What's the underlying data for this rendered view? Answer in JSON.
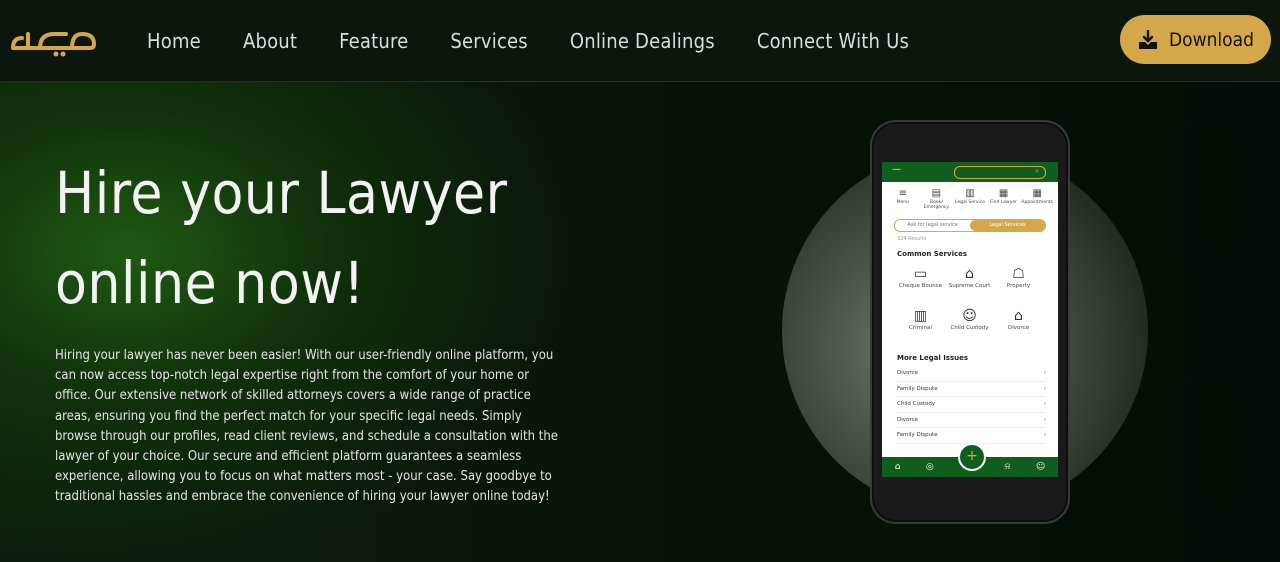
{
  "nav": {
    "links": [
      "Home",
      "About",
      "Feature",
      "Services",
      "Online Dealings",
      "Connect With Us"
    ],
    "download_label": "Download"
  },
  "hero": {
    "title": "Hire your Lawyer online now!",
    "description": "Hiring your lawyer has never been easier! With our user-friendly online platform, you can now access top-notch legal expertise right from the comfort of your home or office. Our extensive network of skilled attorneys covers a wide range of practice areas, ensuring you find the perfect match for your specific legal needs. Simply browse through our profiles, read client reviews, and schedule a consultation with the lawyer of your choice. Our secure and efficient platform guarantees a seamless experience, allowing you to focus on what matters most - your case. Say goodbye to traditional hassles and embrace the convenience of hiring your lawyer online today!"
  },
  "phone": {
    "top_icons": [
      "Menu",
      "Book/ Emergency",
      "Legal Service",
      "Find Lawyer",
      "Appointments"
    ],
    "toggle": [
      "Ask for legal service",
      "Legal Services"
    ],
    "results": "324 Results",
    "common_heading": "Common Services",
    "services": [
      "Cheque Bounce",
      "Supreme Court",
      "Property",
      "Criminal",
      "Child Custody",
      "Divorce"
    ],
    "more_heading": "More Legal Issues",
    "issues": [
      "Divorce",
      "Family Dispute",
      "Child Custody",
      "Divorce",
      "Family Dispute"
    ]
  },
  "colors": {
    "accent": "#d4a84a",
    "app_green": "#0f5e1e"
  }
}
